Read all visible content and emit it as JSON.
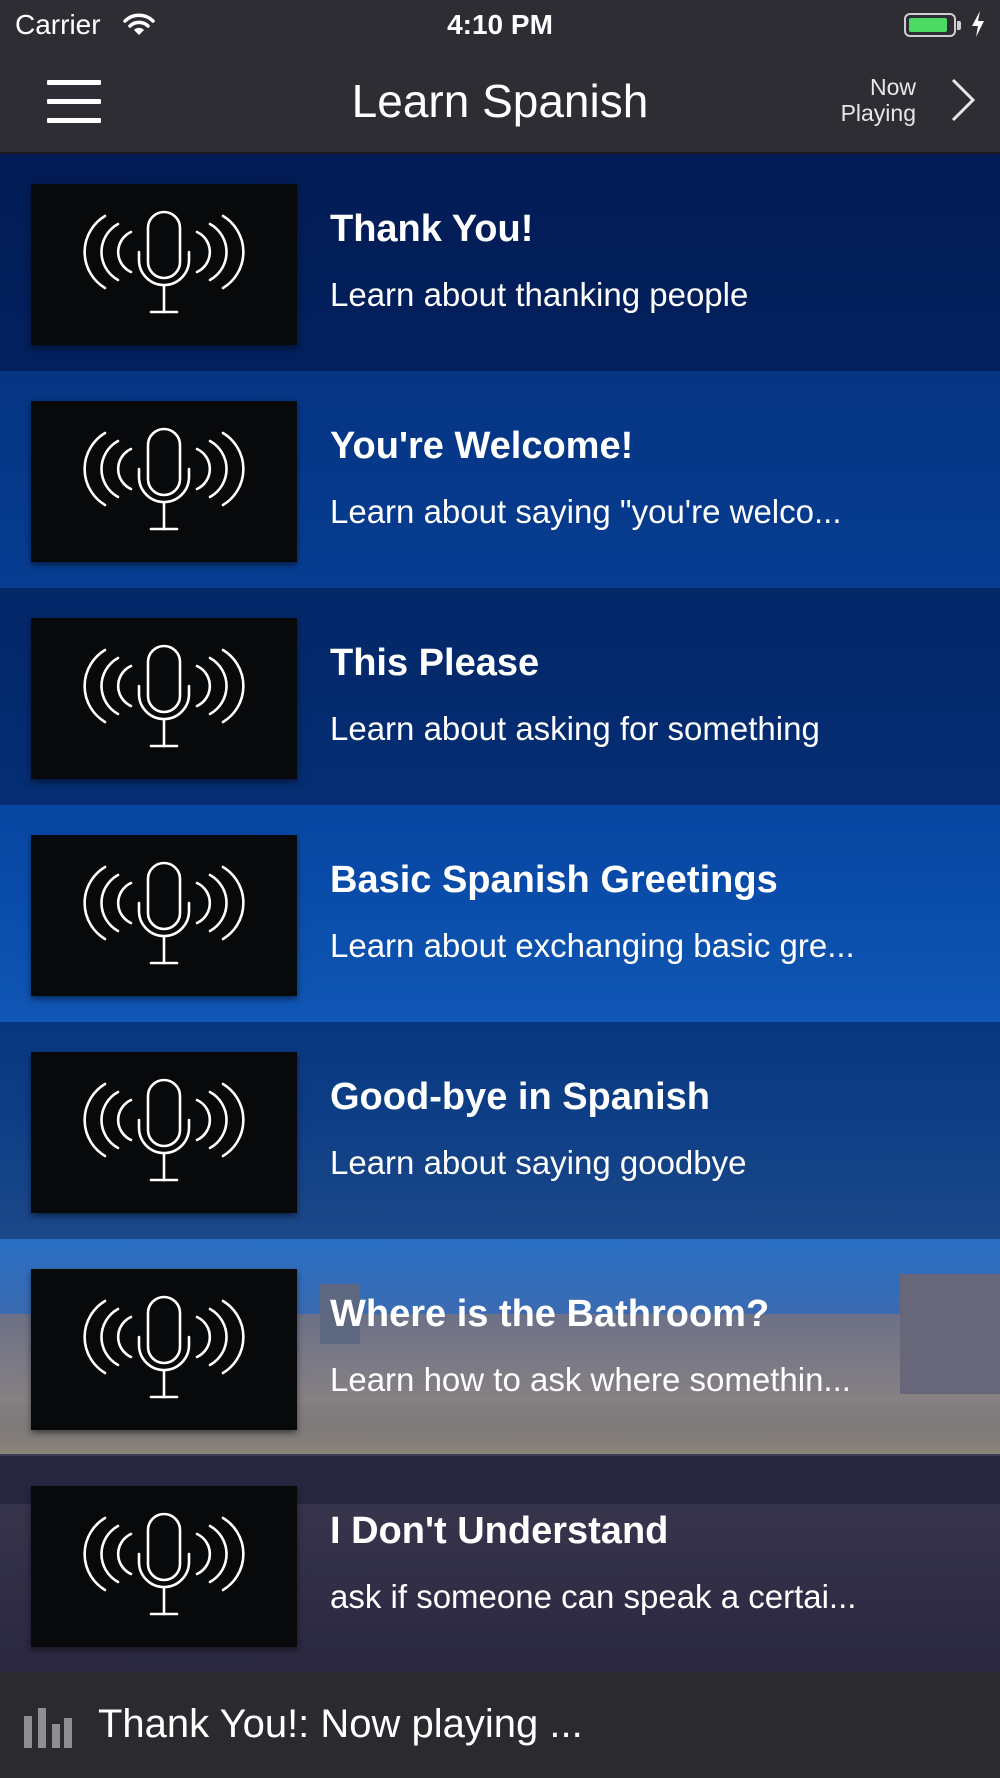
{
  "status_bar": {
    "carrier": "Carrier",
    "time": "4:10 PM"
  },
  "nav": {
    "title": "Learn Spanish",
    "now_playing_line1": "Now",
    "now_playing_line2": "Playing"
  },
  "lessons": [
    {
      "title": "Thank You!",
      "subtitle": "Learn about thanking people"
    },
    {
      "title": "You're Welcome!",
      "subtitle": "Learn about saying \"you're welco..."
    },
    {
      "title": "This Please",
      "subtitle": "Learn about asking for something"
    },
    {
      "title": "Basic Spanish Greetings",
      "subtitle": "Learn about exchanging basic gre..."
    },
    {
      "title": "Good-bye in Spanish",
      "subtitle": "Learn about saying goodbye"
    },
    {
      "title": "Where is the Bathroom?",
      "subtitle": "Learn how to ask where somethin..."
    },
    {
      "title": "I Don't Understand",
      "subtitle": "ask if someone can speak a certai..."
    }
  ],
  "player": {
    "label": "Thank You!: Now playing ..."
  },
  "colors": {
    "battery": "#4cd964",
    "bar": "#2e2d33"
  }
}
